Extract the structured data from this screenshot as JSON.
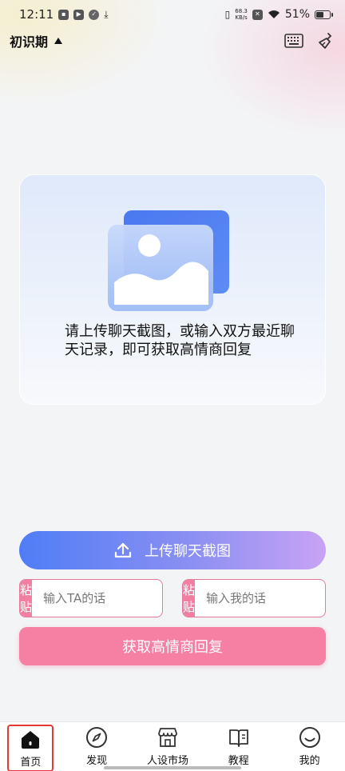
{
  "status_bar": {
    "time": "12:11",
    "speed_value": "68.3",
    "speed_unit": "KB/s",
    "battery": "51%"
  },
  "header": {
    "stage_label": "初识期"
  },
  "upload_card": {
    "prompt": "请上传聊天截图，或输入双方最近聊天记录，即可获取高情商回复"
  },
  "actions": {
    "upload_label": "上传聊天截图",
    "paste_label_ta": "粘贴",
    "ta_placeholder": "输入TA的话",
    "paste_label_me": "粘贴",
    "me_placeholder": "输入我的话",
    "submit_label": "获取高情商回复"
  },
  "nav": {
    "items": [
      {
        "label": "首页",
        "icon": "home-icon",
        "active": true
      },
      {
        "label": "发现",
        "icon": "compass-icon",
        "active": false
      },
      {
        "label": "人设市场",
        "icon": "store-icon",
        "active": false
      },
      {
        "label": "教程",
        "icon": "book-icon",
        "active": false
      },
      {
        "label": "我的",
        "icon": "smile-icon",
        "active": false
      }
    ]
  },
  "colors": {
    "accent_blue": "#4f7df6",
    "accent_pink": "#f580a3",
    "active_outline": "#e53935"
  }
}
